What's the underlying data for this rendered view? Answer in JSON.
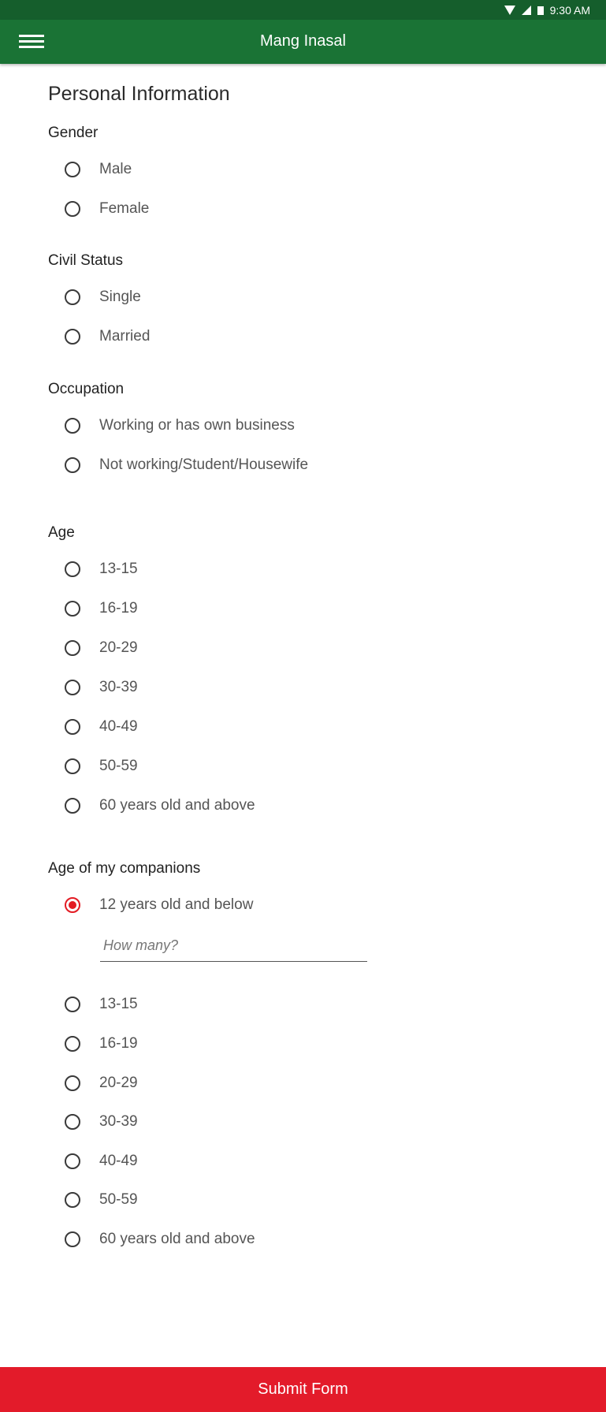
{
  "status": {
    "time": "9:30 AM"
  },
  "app": {
    "title": "Mang Inasal",
    "menu_icon": "hamburger-menu-icon"
  },
  "form": {
    "section_title": "Personal Information",
    "gender": {
      "label": "Gender",
      "options": [
        "Male",
        "Female"
      ]
    },
    "civil_status": {
      "label": "Civil Status",
      "options": [
        "Single",
        "Married"
      ]
    },
    "occupation": {
      "label": "Occupation",
      "options": [
        "Working or has own business",
        "Not working/Student/Housewife"
      ]
    },
    "age": {
      "label": "Age",
      "options": [
        "13-15",
        "16-19",
        "20-29",
        "30-39",
        "40-49",
        "50-59",
        "60 years old and above"
      ]
    },
    "companions": {
      "label": "Age of my companions",
      "selected": "12 years old and below",
      "options": [
        "12 years old and below",
        "13-15",
        "16-19",
        "20-29",
        "30-39",
        "40-49",
        "50-59",
        "60 years old and above"
      ],
      "how_many_placeholder": "How many?"
    },
    "submit_label": "Submit Form"
  },
  "colors": {
    "appbar": "#1a7335",
    "statusbar": "#155e2c",
    "accent": "#e31b23",
    "submit": "#e31b2a"
  }
}
